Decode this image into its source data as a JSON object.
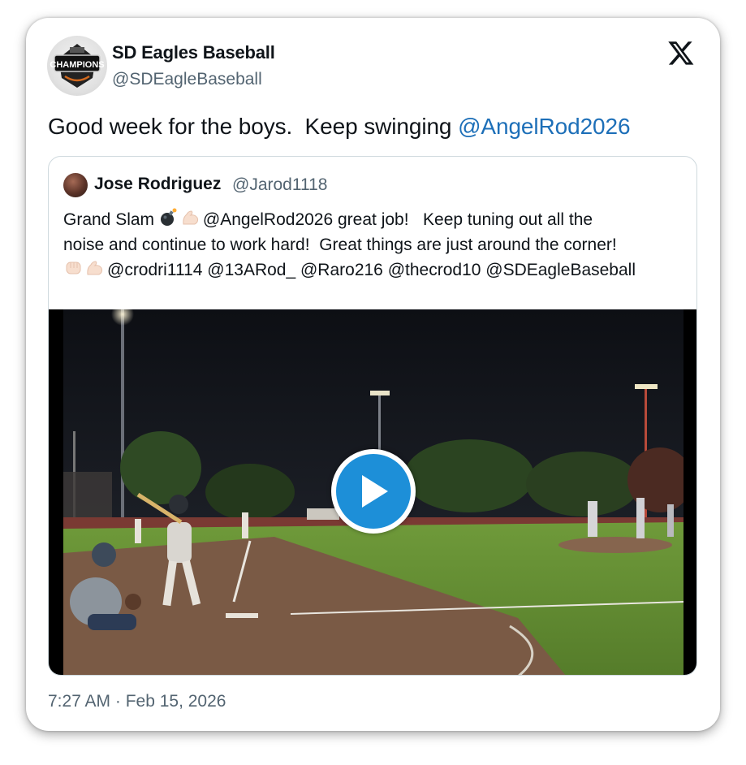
{
  "author": {
    "name": "SD Eagles Baseball",
    "handle": "@SDEagleBaseball",
    "avatar_text": "CHAMPIONS"
  },
  "platform_icon": "x-logo-icon",
  "tweet": {
    "text": "Good week for the boys.  Keep swinging ",
    "mention": "@AngelRod2026"
  },
  "quoted": {
    "name": "Jose Rodriguez",
    "handle": "@Jarod1118",
    "line1_a": "Grand Slam ",
    "line1_b": "@AngelRod2026 great job!   Keep tuning out all the",
    "line2": "noise and continue to work hard!  Great things are just around the corner!",
    "line3": "@crodri1114 @13ARod_ @Raro216 @thecrod10 @SDEagleBaseball",
    "emojis": [
      "bomb-icon",
      "flexed-biceps-icon",
      "fist-bump-icon",
      "flexed-biceps-icon"
    ]
  },
  "media": {
    "type": "video",
    "play_icon": "play-icon"
  },
  "timestamp": "7:27 AM · Feb 15, 2026",
  "colors": {
    "mention": "#1d6fb8",
    "secondary_text": "#536471",
    "play_button": "#1d8fd8",
    "border": "#cfd9de"
  }
}
